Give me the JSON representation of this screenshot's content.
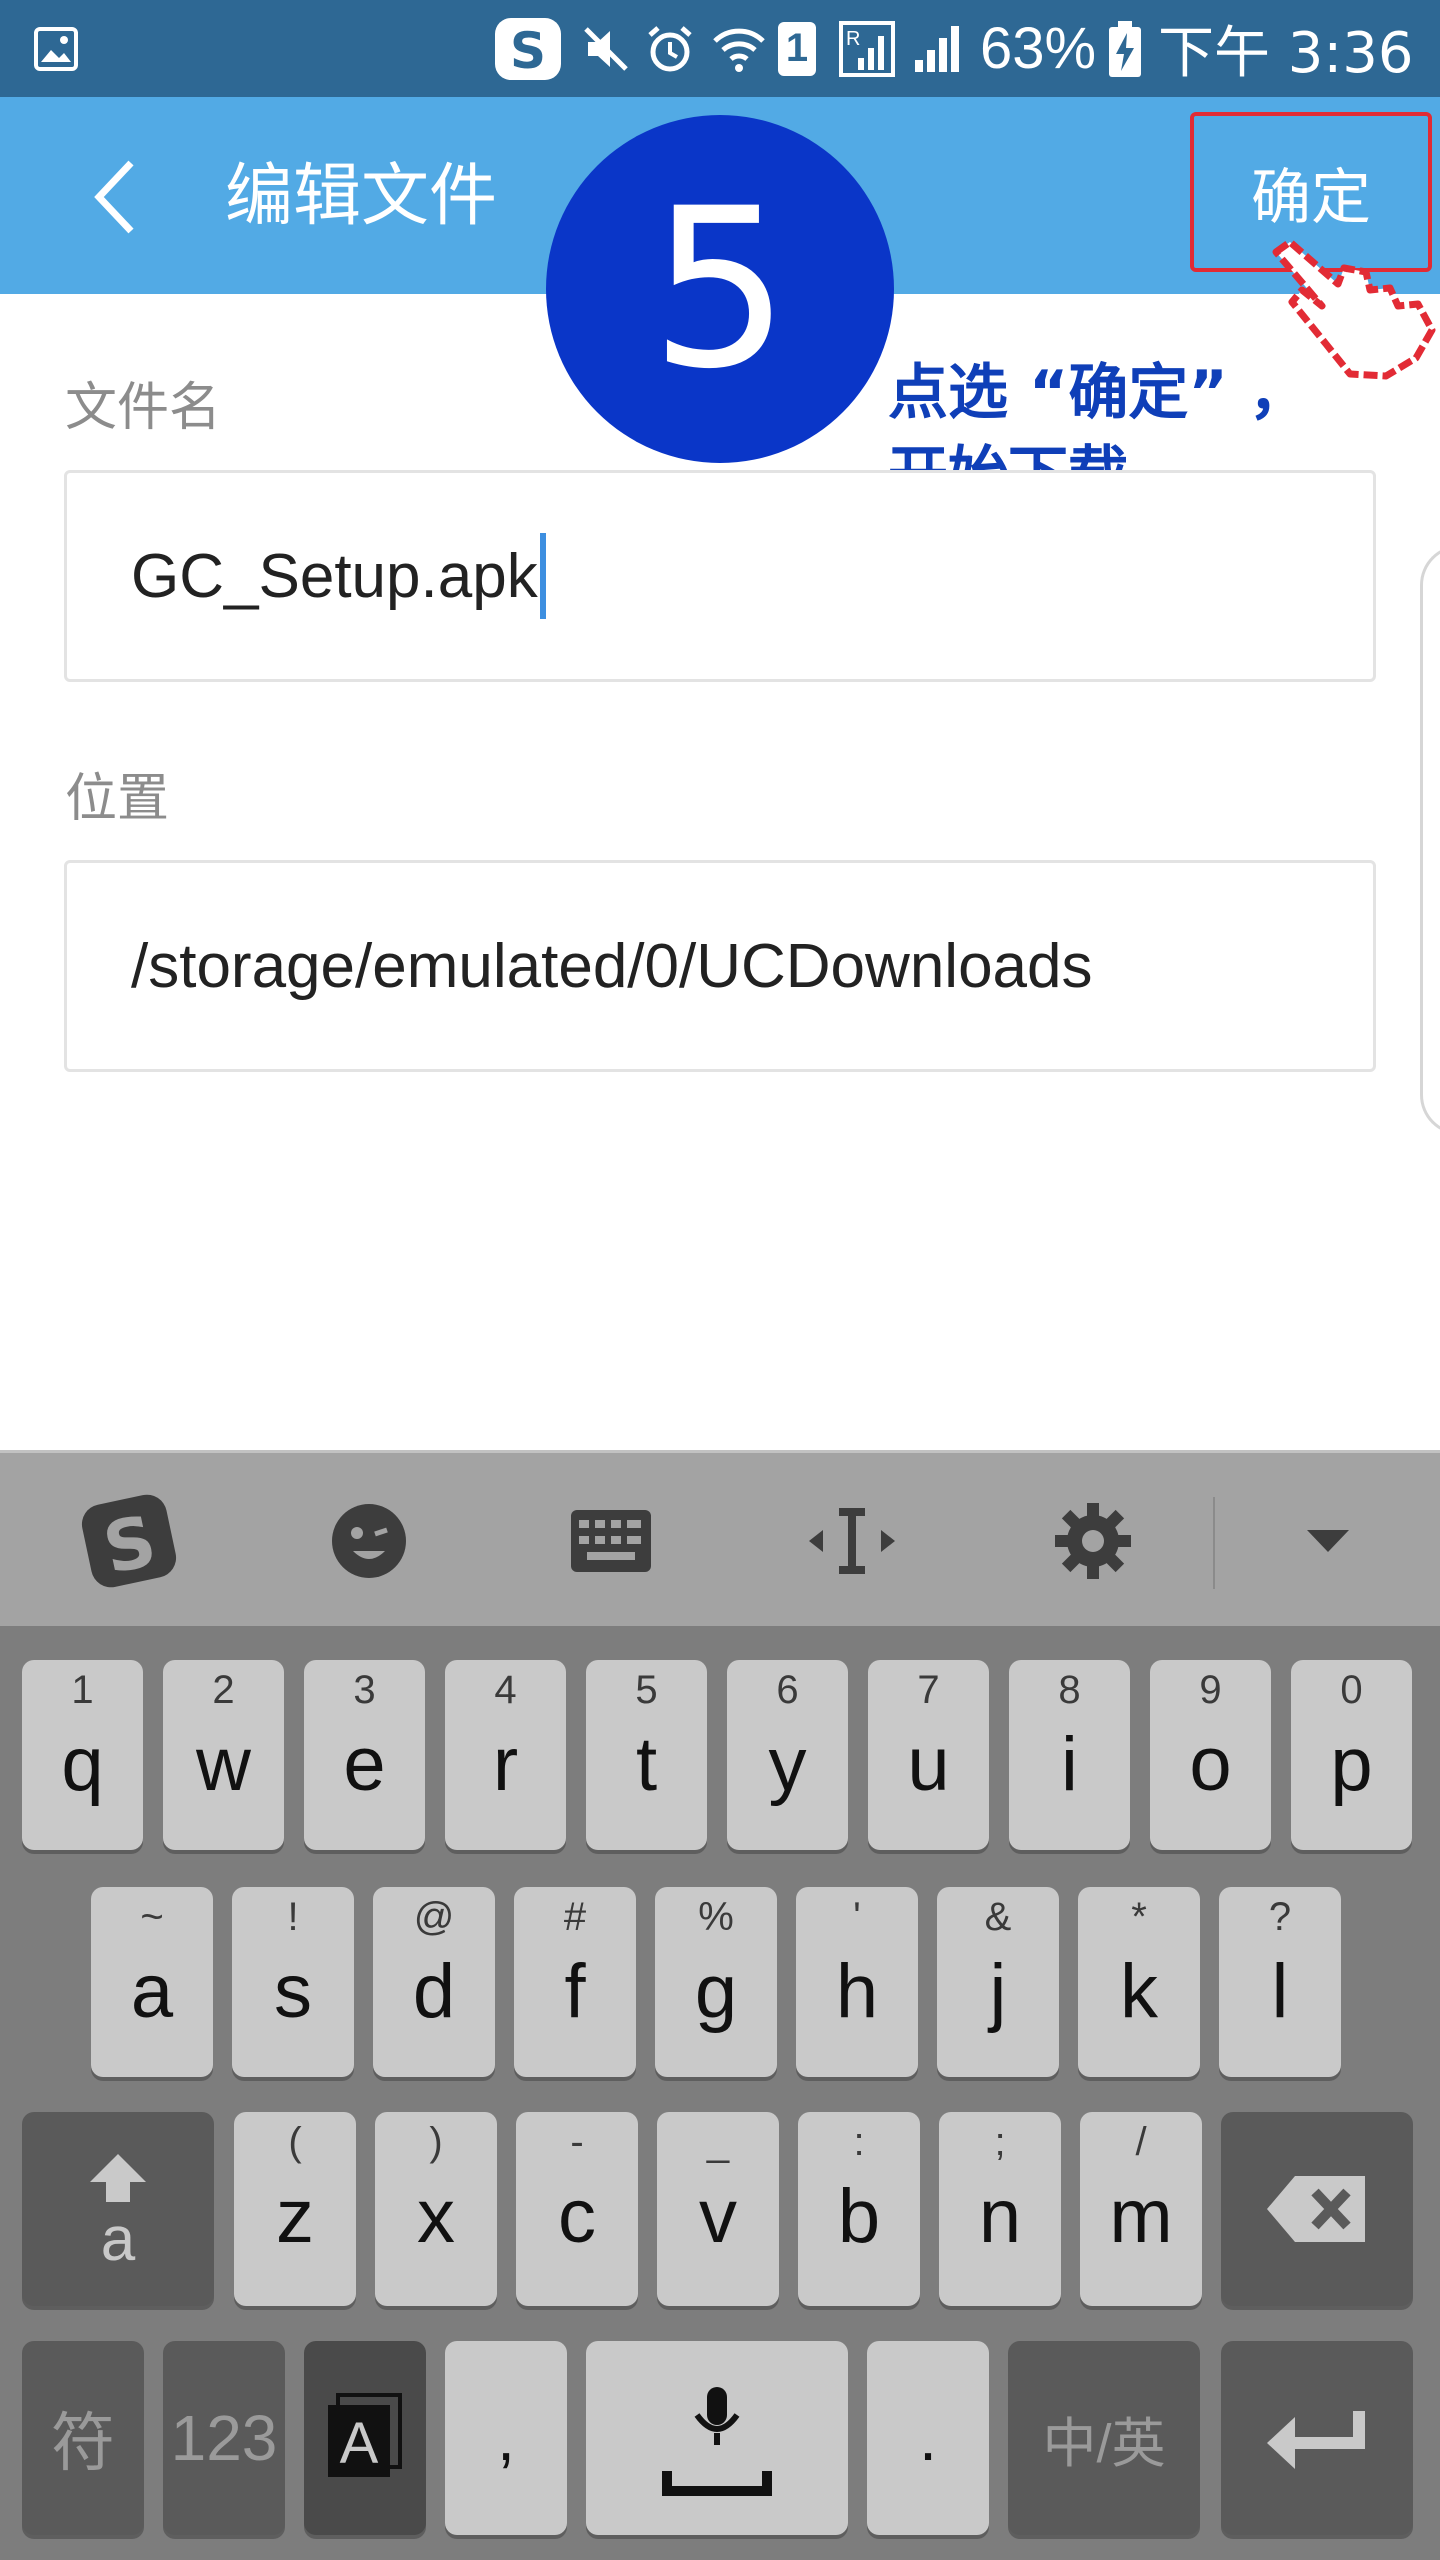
{
  "status_bar": {
    "battery_percent": "63%",
    "time": "下午 3:36",
    "sim_slot": "1",
    "icons": [
      "gallery-icon",
      "sogou-icon",
      "mute-icon",
      "alarm-icon",
      "wifi-icon",
      "sim1-icon",
      "roaming-signal-icon",
      "signal-icon",
      "battery-charging-icon"
    ]
  },
  "header": {
    "title": "编辑文件",
    "confirm_label": "确定",
    "back_icon": "chevron-left-icon"
  },
  "tutorial": {
    "step_number": "5",
    "annotation_line1": "点选 “确定” ，",
    "annotation_line2": "开始下载",
    "pointer_icon": "hand-pointer-icon"
  },
  "form": {
    "filename_label": "文件名",
    "filename_value": "GC_Setup.apk",
    "location_label": "位置",
    "location_value": "/storage/emulated/0/UCDownloads"
  },
  "keyboard": {
    "toolbar_icons": [
      "sogou-logo-icon",
      "emoji-icon",
      "keyboard-icon",
      "cursor-move-icon",
      "settings-icon",
      "collapse-icon"
    ],
    "row1": [
      {
        "sub": "1",
        "main": "q"
      },
      {
        "sub": "2",
        "main": "w"
      },
      {
        "sub": "3",
        "main": "e"
      },
      {
        "sub": "4",
        "main": "r"
      },
      {
        "sub": "5",
        "main": "t"
      },
      {
        "sub": "6",
        "main": "y"
      },
      {
        "sub": "7",
        "main": "u"
      },
      {
        "sub": "8",
        "main": "i"
      },
      {
        "sub": "9",
        "main": "o"
      },
      {
        "sub": "0",
        "main": "p"
      }
    ],
    "row2": [
      {
        "sub": "~",
        "main": "a"
      },
      {
        "sub": "!",
        "main": "s"
      },
      {
        "sub": "@",
        "main": "d"
      },
      {
        "sub": "#",
        "main": "f"
      },
      {
        "sub": "%",
        "main": "g"
      },
      {
        "sub": "'",
        "main": "h"
      },
      {
        "sub": "&",
        "main": "j"
      },
      {
        "sub": "*",
        "main": "k"
      },
      {
        "sub": "?",
        "main": "l"
      }
    ],
    "row3": [
      {
        "sub": "(",
        "main": "z"
      },
      {
        "sub": ")",
        "main": "x"
      },
      {
        "sub": "-",
        "main": "c"
      },
      {
        "sub": "_",
        "main": "v"
      },
      {
        "sub": ":",
        "main": "b"
      },
      {
        "sub": ";",
        "main": "n"
      },
      {
        "sub": "/",
        "main": "m"
      }
    ],
    "shift_label": "a",
    "symbols_label": "符",
    "numbers_label": "123",
    "comma_label": ",",
    "period_label": ".",
    "lang_switch_label": "中/英",
    "colors": {
      "key": "#c9c9c9",
      "dark_key": "#5a5a5a",
      "background": "#7d7d7d"
    }
  },
  "colors": {
    "status_bar": "#2e6894",
    "header": "#52aae5",
    "step_badge": "#0a36c8",
    "annotation_text": "#0f3fb8",
    "highlight_border": "#e22b35",
    "cursor": "#3d8fe0"
  }
}
